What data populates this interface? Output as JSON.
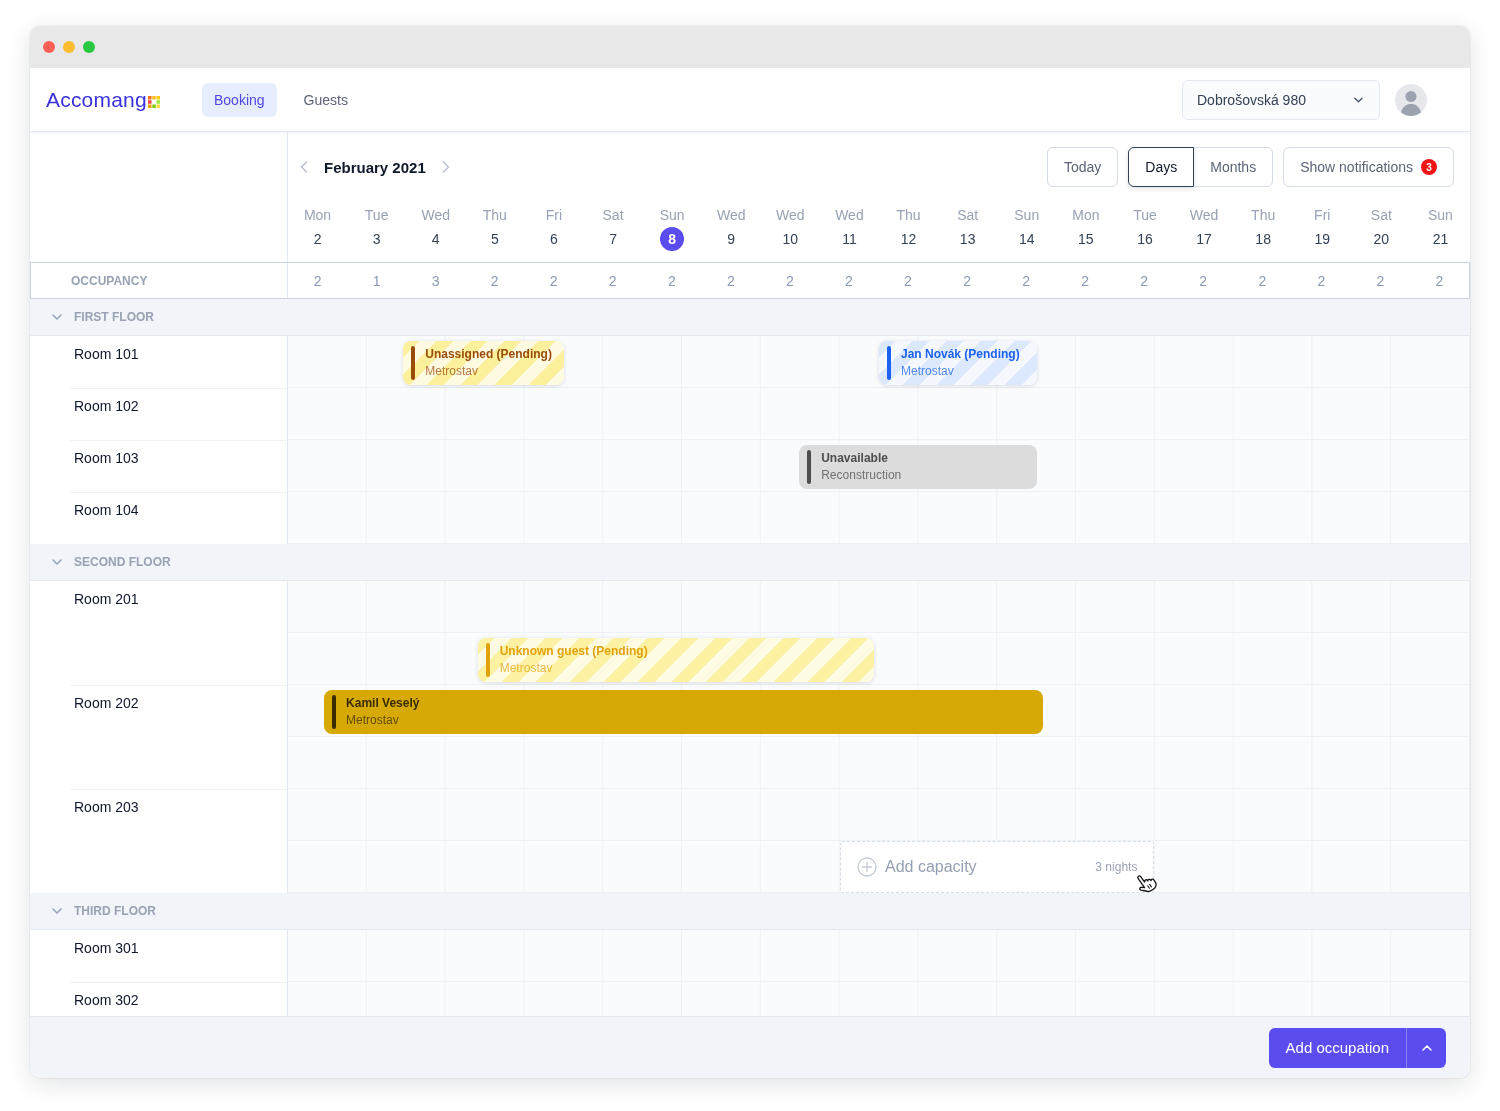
{
  "nav": {
    "logo": "Accomang",
    "tabs": [
      {
        "label": "Booking",
        "selected": true
      },
      {
        "label": "Guests",
        "selected": false
      }
    ],
    "property_select": {
      "value": "Dobrošovská 980"
    }
  },
  "calendar": {
    "month": "February 2021",
    "today_button": "Today",
    "views": [
      {
        "label": "Days",
        "selected": true
      },
      {
        "label": "Months",
        "selected": false
      }
    ],
    "notifications": {
      "label": "Show notifications",
      "count": "3"
    },
    "days": [
      {
        "weekday": "Mon",
        "day": "2",
        "today": false
      },
      {
        "weekday": "Tue",
        "day": "3",
        "today": false
      },
      {
        "weekday": "Wed",
        "day": "4",
        "today": false
      },
      {
        "weekday": "Thu",
        "day": "5",
        "today": false
      },
      {
        "weekday": "Fri",
        "day": "6",
        "today": false
      },
      {
        "weekday": "Sat",
        "day": "7",
        "today": false
      },
      {
        "weekday": "Sun",
        "day": "8",
        "today": true
      },
      {
        "weekday": "Wed",
        "day": "9",
        "today": false
      },
      {
        "weekday": "Wed",
        "day": "10",
        "today": false
      },
      {
        "weekday": "Wed",
        "day": "11",
        "today": false
      },
      {
        "weekday": "Thu",
        "day": "12",
        "today": false
      },
      {
        "weekday": "Sat",
        "day": "13",
        "today": false
      },
      {
        "weekday": "Sun",
        "day": "14",
        "today": false
      },
      {
        "weekday": "Mon",
        "day": "15",
        "today": false
      },
      {
        "weekday": "Tue",
        "day": "16",
        "today": false
      },
      {
        "weekday": "Wed",
        "day": "17",
        "today": false
      },
      {
        "weekday": "Thu",
        "day": "18",
        "today": false
      },
      {
        "weekday": "Fri",
        "day": "19",
        "today": false
      },
      {
        "weekday": "Sat",
        "day": "20",
        "today": false
      },
      {
        "weekday": "Sun",
        "day": "21",
        "today": false
      }
    ],
    "occupancy": {
      "label": "OCCUPANCY",
      "values": [
        "2",
        "1",
        "3",
        "2",
        "2",
        "2",
        "2",
        "2",
        "2",
        "2",
        "2",
        "2",
        "2",
        "2",
        "2",
        "2",
        "2",
        "2",
        "2",
        "2"
      ]
    }
  },
  "floors": [
    {
      "name": "FIRST FLOOR",
      "expanded": true,
      "rooms": [
        {
          "name": "Room 101",
          "bookings": [
            {
              "kind": "pending",
              "title": "Unassigned (Pending)",
              "subtitle": "Metrostav",
              "color": "#fdf09c",
              "accent": {
                "color": "#9a4d0b"
              }
            },
            {
              "kind": "pending",
              "title": "Jan Novák (Pending)",
              "subtitle": "Metrostav",
              "color": "#dbe8fd",
              "accent": {
                "color": "#1d62ee"
              }
            }
          ]
        },
        {
          "name": "Room 102"
        },
        {
          "name": "Room 103",
          "bookings": [
            {
              "kind": "blocked",
              "title": "Unavailable",
              "subtitle": "Reconstruction",
              "color": "#dcdcdc",
              "accent": {
                "color": "#4d4d4d"
              }
            }
          ]
        },
        {
          "name": "Room 104"
        }
      ]
    },
    {
      "name": "SECOND FLOOR",
      "expanded": true,
      "rooms": [
        {
          "name": "Room 201",
          "bookings": [
            {
              "kind": "pending",
              "title": "Unknown guest (Pending)",
              "subtitle": "Metrostav",
              "color": "#fdf2a4",
              "accent": {
                "color": "#e2a20b"
              }
            }
          ]
        },
        {
          "name": "Room 202",
          "bookings": [
            {
              "kind": "confirmed",
              "title": "Kamil Veselý",
              "subtitle": "Metrostav",
              "color": "#d6a904",
              "accent": {
                "color": "#3a2c00"
              }
            }
          ]
        },
        {
          "name": "Room 203",
          "bookings": [
            {
              "kind": "placeholder",
              "title": "Add capacity",
              "subtitle": "3 nights"
            }
          ]
        }
      ]
    },
    {
      "name": "THIRD FLOOR",
      "expanded": true,
      "rooms": [
        {
          "name": "Room 301"
        },
        {
          "name": "Room 302"
        }
      ]
    }
  ],
  "footer": {
    "add_button": "Add occupation"
  }
}
